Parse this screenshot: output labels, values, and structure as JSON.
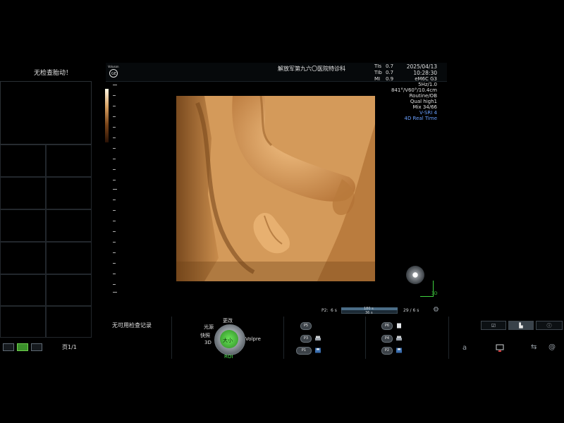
{
  "left_panel": {
    "title": "无检查胎动！",
    "page_label": "页1/1"
  },
  "topbar": {
    "logo_text": "Voluson",
    "hospital": "解放军第九六〇医院特诊科",
    "indices": [
      {
        "name": "TIs",
        "value": "0.7"
      },
      {
        "name": "TIb",
        "value": "0.7"
      },
      {
        "name": "MI",
        "value": "0.9"
      }
    ],
    "date": "2025/04/13",
    "time": "10:28:30"
  },
  "params": {
    "probe": "eM6C G3",
    "freq": "5Hz/1.0",
    "geometry": "841°/V60°/10.4cm",
    "preset": "Routine/OB",
    "quality": "Qual high1",
    "mix": "Mix 34/66",
    "vsri": "V-SRI 4",
    "mode": "4D Real Time"
  },
  "viewport": {
    "corner_label": "3D"
  },
  "timeline": {
    "label": "P2:",
    "left_value": "6 s",
    "bar_top": "180 s",
    "bar_bottom": "36 s",
    "right_value": "29 / 6 s"
  },
  "bottom": {
    "no_record": "无可用检查记录",
    "knob": {
      "top": "更改",
      "upper_left": "光源",
      "mid_left": "快照",
      "lower_left": "3D",
      "center": "大小",
      "right": "Volpre",
      "bottom": "ROI"
    },
    "p_buttons_left": [
      "P5",
      "P3",
      "P1"
    ],
    "p_buttons_right": [
      "P6",
      "P4",
      "P2"
    ],
    "right_tabs": [
      "☑",
      "▙",
      "ⓘ"
    ],
    "status": {
      "a_letter": "a",
      "network": "⇆",
      "at": "@"
    }
  },
  "colors": {
    "accent_green": "#3fd23f",
    "image_tone": "#c98a45",
    "blue_text": "#6aa0ff"
  }
}
